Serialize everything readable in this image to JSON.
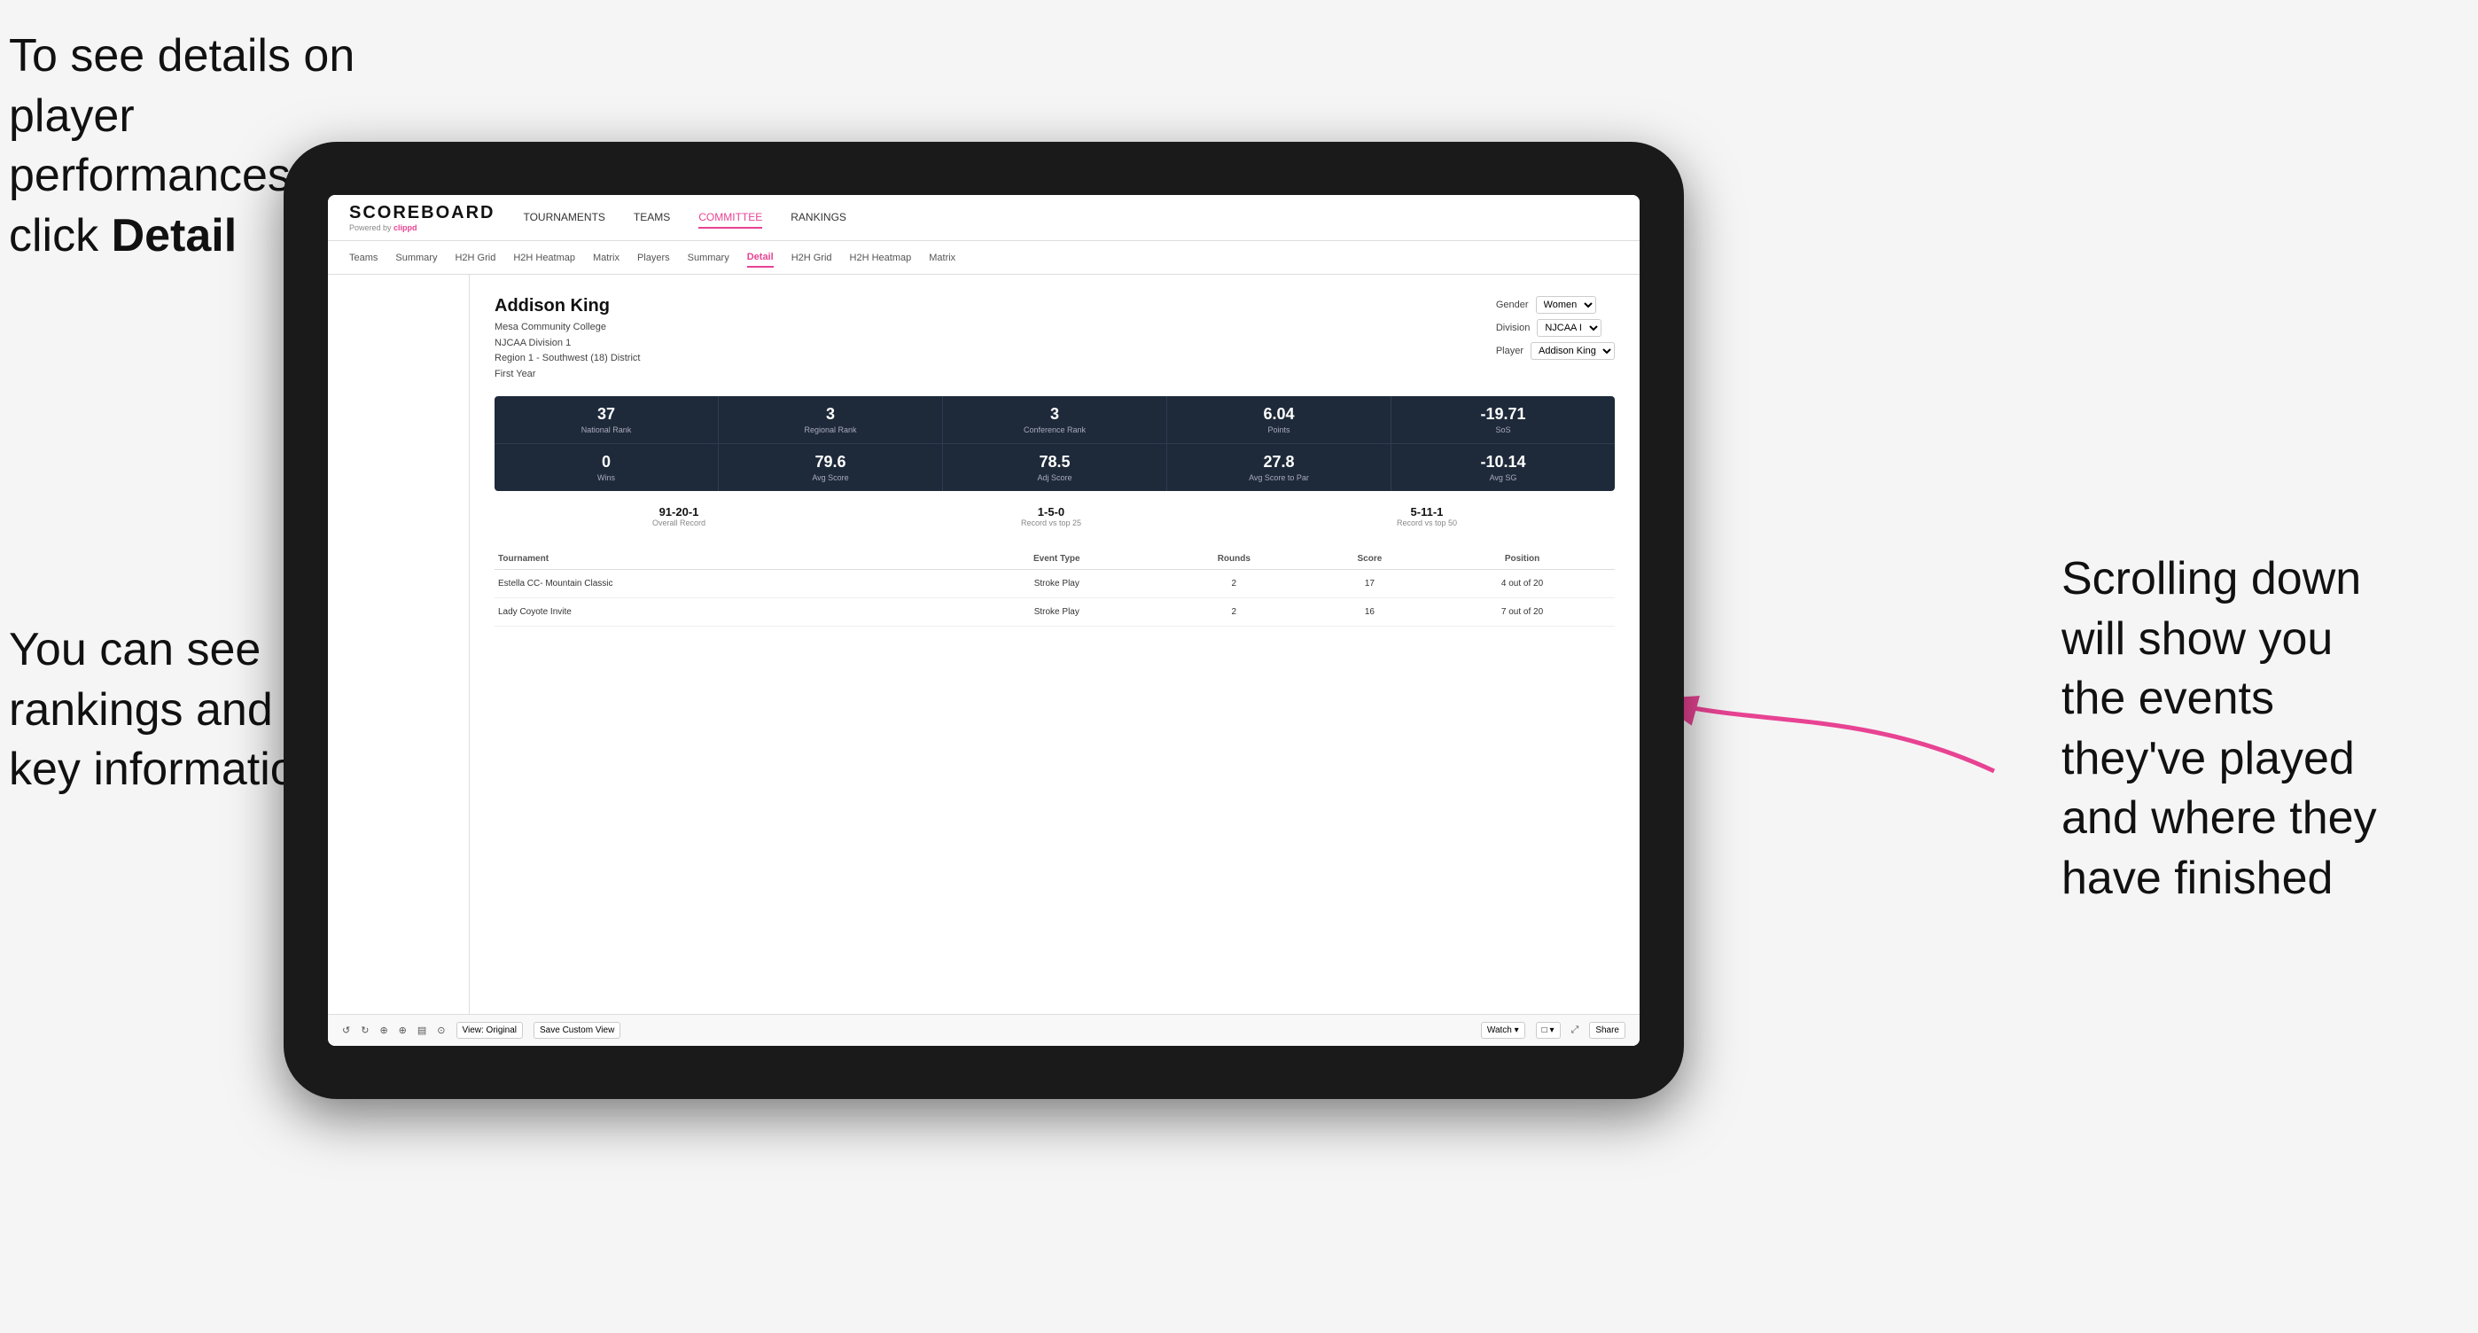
{
  "annotations": {
    "top_left": {
      "line1": "To see details on",
      "line2": "player performances",
      "line3_prefix": "click ",
      "line3_bold": "Detail"
    },
    "bottom_left": {
      "line1": "You can see",
      "line2": "rankings and",
      "line3": "key information"
    },
    "right": {
      "line1": "Scrolling down",
      "line2": "will show you",
      "line3": "the events",
      "line4": "they've played",
      "line5": "and where they",
      "line6": "have finished"
    }
  },
  "nav": {
    "logo": "SCOREBOARD",
    "powered_by": "Powered by",
    "clippd": "clippd",
    "items": [
      "TOURNAMENTS",
      "TEAMS",
      "COMMITTEE",
      "RANKINGS"
    ]
  },
  "sub_nav": {
    "items": [
      "Teams",
      "Summary",
      "H2H Grid",
      "H2H Heatmap",
      "Matrix",
      "Players",
      "Summary",
      "Detail",
      "H2H Grid",
      "H2H Heatmap",
      "Matrix"
    ]
  },
  "player": {
    "name": "Addison King",
    "college": "Mesa Community College",
    "division": "NJCAA Division 1",
    "region": "Region 1 - Southwest (18) District",
    "year": "First Year",
    "selectors": {
      "gender_label": "Gender",
      "gender_value": "Women",
      "division_label": "Division",
      "division_value": "NJCAA I",
      "player_label": "Player",
      "player_value": "Addison King"
    }
  },
  "stats_row1": [
    {
      "value": "37",
      "label": "National Rank"
    },
    {
      "value": "3",
      "label": "Regional Rank"
    },
    {
      "value": "3",
      "label": "Conference Rank"
    },
    {
      "value": "6.04",
      "label": "Points"
    },
    {
      "value": "-19.71",
      "label": "SoS"
    }
  ],
  "stats_row2": [
    {
      "value": "0",
      "label": "Wins"
    },
    {
      "value": "79.6",
      "label": "Avg Score"
    },
    {
      "value": "78.5",
      "label": "Adj Score"
    },
    {
      "value": "27.8",
      "label": "Avg Score to Par"
    },
    {
      "value": "-10.14",
      "label": "Avg SG"
    }
  ],
  "records": [
    {
      "value": "91-20-1",
      "label": "Overall Record"
    },
    {
      "value": "1-5-0",
      "label": "Record vs top 25"
    },
    {
      "value": "5-11-1",
      "label": "Record vs top 50"
    }
  ],
  "table": {
    "headers": [
      "Tournament",
      "Event Type",
      "Rounds",
      "Score",
      "Position"
    ],
    "rows": [
      {
        "tournament": "Estella CC- Mountain Classic",
        "event_type": "Stroke Play",
        "rounds": "2",
        "score": "17",
        "position": "4 out of 20"
      },
      {
        "tournament": "Lady Coyote Invite",
        "event_type": "Stroke Play",
        "rounds": "2",
        "score": "16",
        "position": "7 out of 20"
      }
    ]
  },
  "toolbar": {
    "items": [
      "↺",
      "↻",
      "⊕",
      "⊕",
      "▤",
      "⊙",
      "View: Original",
      "Save Custom View",
      "Watch ▾",
      "□ ▾",
      "⤢",
      "Share"
    ]
  }
}
